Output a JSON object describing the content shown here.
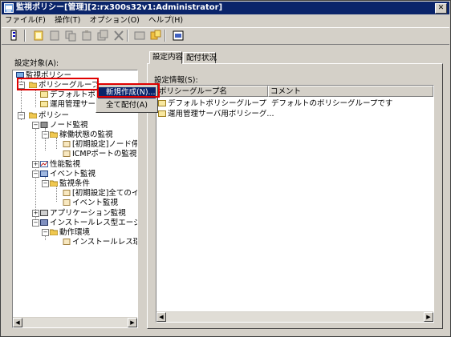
{
  "window": {
    "title": "監視ポリシー[管理][2:rx300s32v1:Administrator]",
    "close_label": "✕"
  },
  "menu": [
    {
      "label": "ファイル(F)"
    },
    {
      "label": "操作(T)"
    },
    {
      "label": "オプション(O)"
    },
    {
      "label": "ヘルプ(H)"
    }
  ],
  "left": {
    "label": "設定対象(A):",
    "tree": [
      {
        "label": "監視ポリシー"
      },
      {
        "label": "ポリシーグループ"
      },
      {
        "label": "デフォルトポリ"
      },
      {
        "label": "運用管理サーバ"
      },
      {
        "label": "ポリシー"
      },
      {
        "label": "ノード監視"
      },
      {
        "label": "稼働状態の監視"
      },
      {
        "label": "[初期設定]ノード停"
      },
      {
        "label": "ICMPポートの監視"
      },
      {
        "label": "性能監視"
      },
      {
        "label": "イベント監視"
      },
      {
        "label": "監視条件"
      },
      {
        "label": "[初期設定]全てのイ"
      },
      {
        "label": "イベント監視"
      },
      {
        "label": "アプリケーション監視"
      },
      {
        "label": "インストールレス型エージ"
      },
      {
        "label": "動作環境"
      },
      {
        "label": "インストールレス環"
      }
    ]
  },
  "context_menu": [
    {
      "label": "新規作成(N)..."
    },
    {
      "label": "全て配付(A)"
    }
  ],
  "tabs": [
    {
      "label": "設定内容"
    },
    {
      "label": "配付状況"
    }
  ],
  "right": {
    "label": "設定情報(S):",
    "columns": [
      "ポリシーグループ名",
      "コメント"
    ],
    "rows": [
      {
        "name": "デフォルトポリシーグループ",
        "comment": "デフォルトのポリシーグループです"
      },
      {
        "name": "運用管理サーバ用ポリシーグ...",
        "comment": ""
      }
    ]
  },
  "colors": {
    "title_bg": "#0a246a",
    "highlight": "#e00000",
    "selection": "#0a246a",
    "chrome": "#d4d0c8"
  }
}
